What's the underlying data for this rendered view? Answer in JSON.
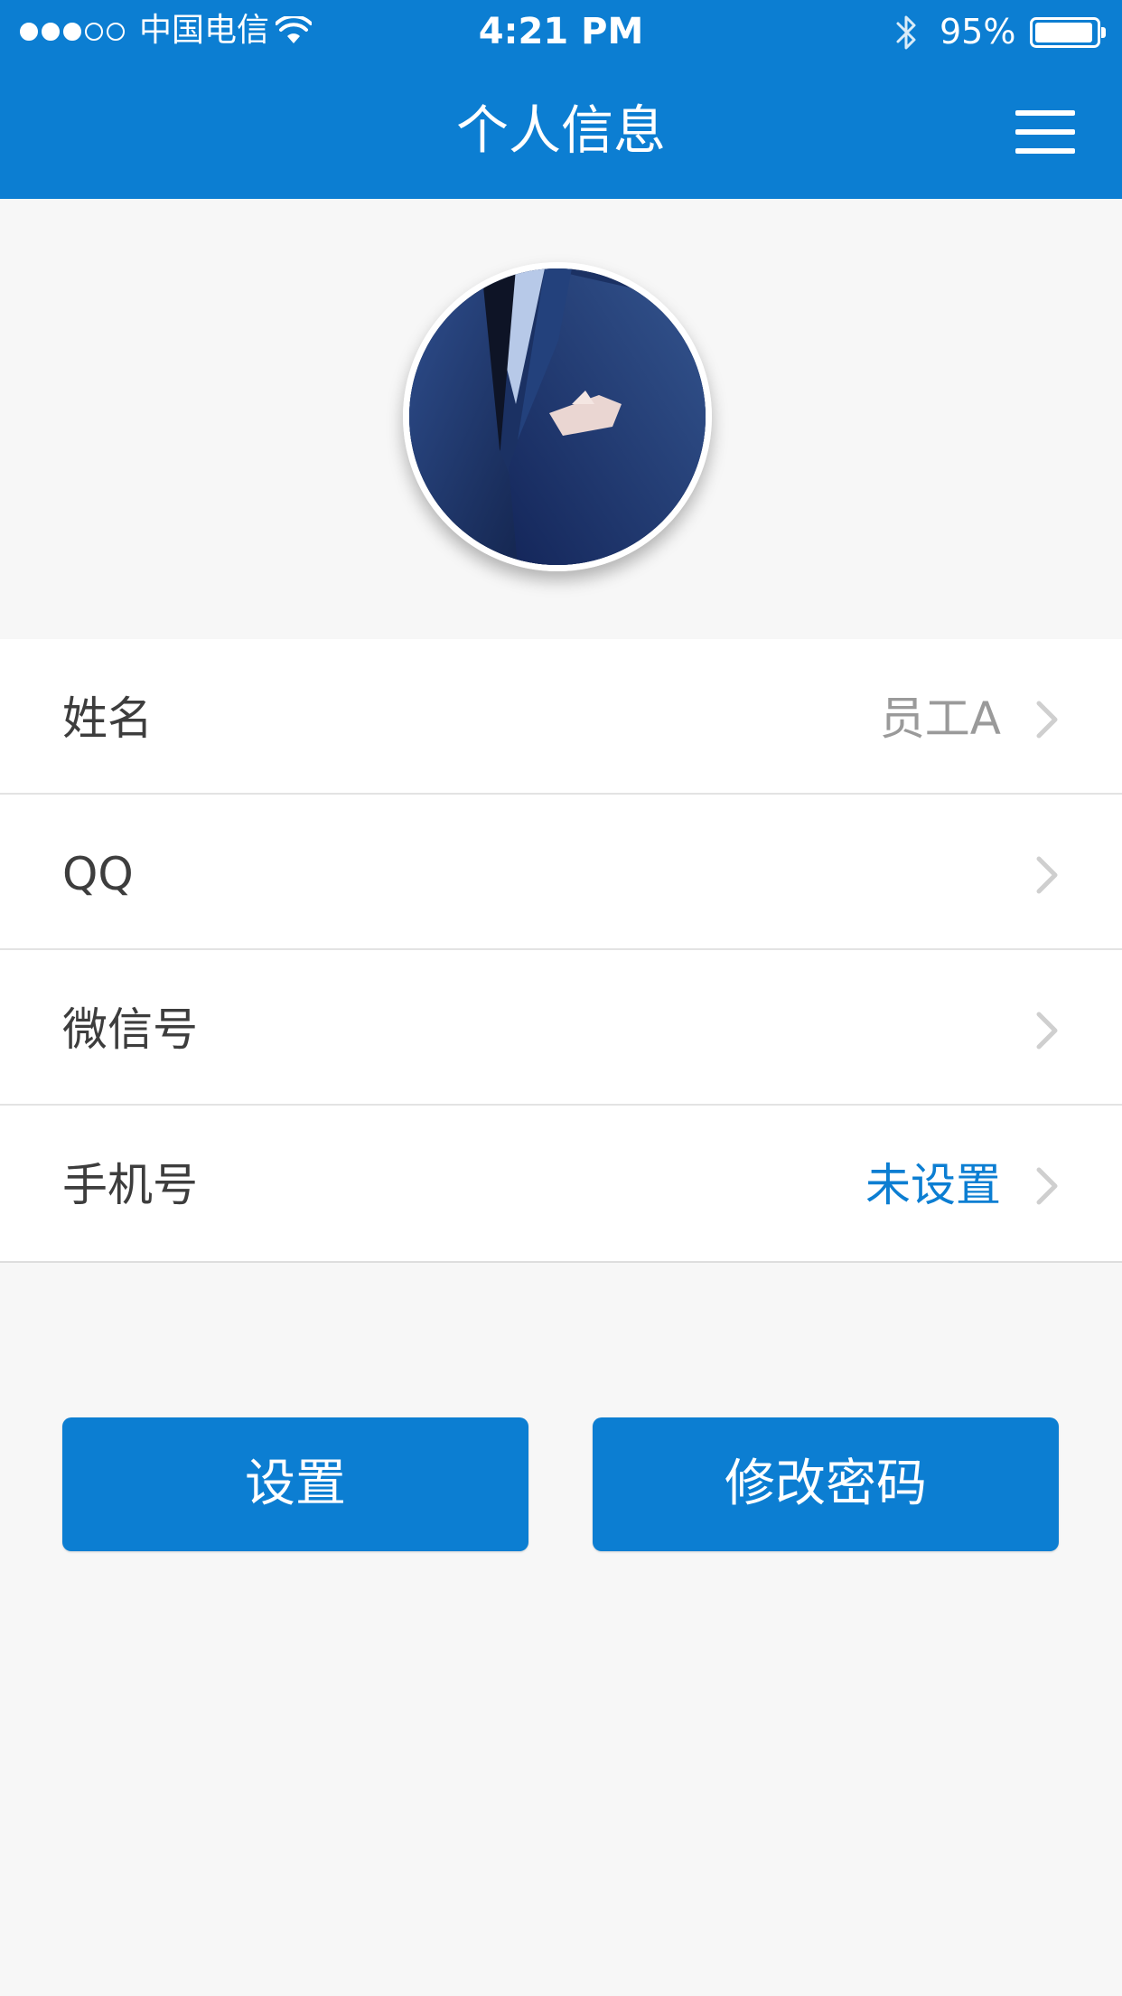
{
  "status_bar": {
    "carrier": "中国电信",
    "time": "4:21 PM",
    "battery_percent": "95%",
    "signal_strength": 3,
    "signal_max": 5,
    "battery_level": 0.95
  },
  "nav": {
    "title": "个人信息",
    "menu_icon": "hamburger-menu-icon"
  },
  "avatar": {
    "icon": "user-avatar"
  },
  "profile_rows": [
    {
      "label": "姓名",
      "value": "员工A",
      "value_color": "#9a9a9a"
    },
    {
      "label": "QQ",
      "value": ""
    },
    {
      "label": "微信号",
      "value": ""
    },
    {
      "label": "手机号",
      "value": "未设置",
      "value_color": "#0c7ed2"
    }
  ],
  "actions": {
    "settings_label": "设置",
    "change_password_label": "修改密码"
  },
  "colors": {
    "primary": "#0c7ed2",
    "background": "#f7f7f7"
  }
}
